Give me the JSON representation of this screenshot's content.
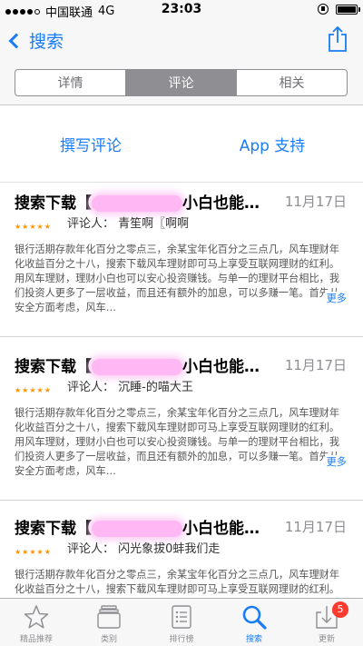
{
  "status_bar": {
    "carrier": "中国联通",
    "network": "4G",
    "time": "23:03"
  },
  "nav": {
    "back_label": "搜索",
    "share_icon": "share-icon"
  },
  "segmented": {
    "tabs": [
      "详情",
      "评论",
      "相关"
    ],
    "active": 1
  },
  "actions": {
    "write_review": "撰写评论",
    "app_support": "App 支持"
  },
  "reviews": [
    {
      "title_start": "搜索下载【",
      "title_end": "小白也能…",
      "date": "11月17日",
      "stars": "★★★★★",
      "reviewer": "评论人：  青笙啊〖啊啊",
      "body": "银行活期存款年化百分之零点三，余某宝年化百分之三点几，风车理财年化收益百分之十八，搜索下载风车理财即可马上享受互联网理财的红利。用风车理财，理财小白也可以安心投资赚钱。与单一的理财平台相比，我们投资人更多了一层收益，而且还有额外的加息，可以多赚一笔。首先从安全方面考虑，风车…",
      "more": "更多"
    },
    {
      "title_start": "搜索下载【",
      "title_end": "小白也能…",
      "date": "11月17日",
      "stars": "★★★★★",
      "reviewer": "评论人：  沉睡-的喵大王",
      "body": "银行活期存款年化百分之零点三，余某宝年化百分之三点几，风车理财年化收益百分之十八，搜索下载风车理财即可马上享受互联网理财的红利。用风车理财，理财小白也可以安心投资赚钱。与单一的理财平台相比，我们投资人更多了一层收益，而且还有额外的加息，可以多赚一笔。首先从安全方面考虑，风车…",
      "more": "更多"
    },
    {
      "title_start": "搜索下载【",
      "title_end": "小白也能…",
      "date": "11月17日",
      "stars": "★★★★★",
      "reviewer": "评论人：  闪光象拔0蚌我们走",
      "body": "银行活期存款年化百分之零点三，余某宝年化百分之三点几，风车理财年化收益百分之十八，搜索下载风车理财即可马上享受互联网理财的红利。用风车理财，理财小白也可以安心投资赚钱。",
      "more": ""
    }
  ],
  "tabbar": {
    "items": [
      {
        "label": "精品推荐",
        "icon": "star-icon"
      },
      {
        "label": "类别",
        "icon": "categories-icon"
      },
      {
        "label": "排行榜",
        "icon": "list-icon"
      },
      {
        "label": "搜索",
        "icon": "search-icon"
      },
      {
        "label": "更新",
        "icon": "download-icon",
        "badge": "5"
      }
    ],
    "active": 3
  },
  "colors": {
    "accent": "#1a7cf5",
    "star": "#ff9500",
    "badge": "#ff3b30"
  }
}
